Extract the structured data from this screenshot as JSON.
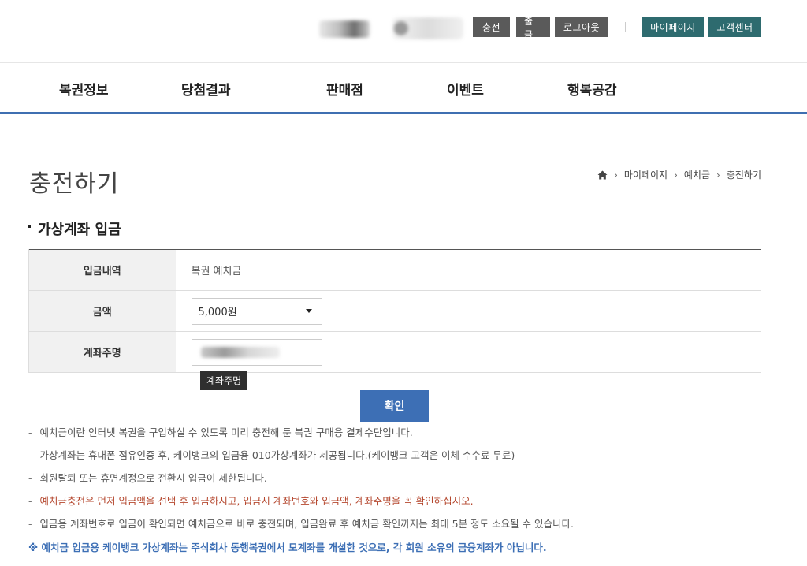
{
  "header": {
    "buttons": {
      "charge": "충전",
      "withdraw": "출금",
      "logout": "로그아웃",
      "mypage": "마이페이지",
      "support": "고객센터"
    }
  },
  "nav": {
    "items": [
      "복권정보",
      "당첨결과",
      "판매점",
      "이벤트",
      "행복공감"
    ]
  },
  "page": {
    "title": "충전하기",
    "breadcrumb": [
      "마이페이지",
      "예치금",
      "충전하기"
    ]
  },
  "section": {
    "title": "가상계좌 입금"
  },
  "form": {
    "deposit_label": "입금내역",
    "deposit_value": "복권 예치금",
    "amount_label": "금액",
    "amount_value": "5,000원",
    "account_name_label": "계좌주명",
    "tooltip": "계좌주명"
  },
  "confirm_button": "확인",
  "notes": [
    "예치금이란 인터넷 복권을 구입하실 수 있도록 미리 충전해 둔 복권 구매용 결제수단입니다.",
    "가상계좌는 휴대폰 점유인증 후, 케이뱅크의 입금용 010가상계좌가 제공됩니다.(케이뱅크 고객은 이체 수수료 무료)",
    "회원탈퇴 또는 휴면계정으로 전환시 입금이 제한됩니다.",
    "예치금충전은 먼저 입금액을 선택 후 입금하시고, 입금시 계좌번호와 입금액, 계좌주명을 꼭 확인하십시오.",
    "입금용 계좌번호로 입금이 확인되면 예치금으로 바로 충전되며, 입금완료 후 예치금 확인까지는 최대 5분 정도 소요될 수 있습니다."
  ],
  "notice": "※ 예치금 입금용 케이뱅크 가상계좌는 주식회사 동행복권에서 모계좌를 개설한 것으로, 각 회원 소유의 금융계좌가 아닙니다."
}
